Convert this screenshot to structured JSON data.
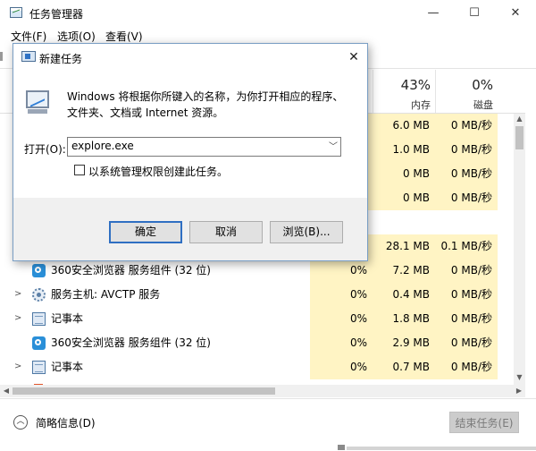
{
  "task_manager": {
    "title": "任务管理器",
    "window_buttons": {
      "minimize": "—",
      "maximize": "☐",
      "close": "✕"
    },
    "menu": [
      "文件(F)",
      "选项(O)",
      "查看(V)"
    ],
    "columns": {
      "memory": {
        "pct": "43%",
        "label": "内存"
      },
      "disk": {
        "pct": "0%",
        "label": "磁盘"
      }
    },
    "rows": [
      {
        "name": "",
        "cpu": "",
        "mem": "6.0 MB",
        "disk": "0 MB/秒"
      },
      {
        "name": "",
        "cpu": "",
        "mem": "1.0 MB",
        "disk": "0 MB/秒"
      },
      {
        "name": "",
        "cpu": "",
        "mem": "0 MB",
        "disk": "0 MB/秒"
      },
      {
        "name": "",
        "cpu": "",
        "mem": "0 MB",
        "disk": "0 MB/秒"
      },
      {
        "name": "",
        "cpu": "",
        "mem": "28.1 MB",
        "disk": "0.1 MB/秒"
      },
      {
        "name": "360安全浏览器 服务组件 (32 位)",
        "icon": "360-browser-icon",
        "expand": false,
        "cpu": "0%",
        "mem": "7.2 MB",
        "disk": "0 MB/秒"
      },
      {
        "name": "服务主机: AVCTP 服务",
        "icon": "service-host-icon",
        "expand": true,
        "cpu": "0%",
        "mem": "0.4 MB",
        "disk": "0 MB/秒"
      },
      {
        "name": "记事本",
        "icon": "notepad-icon",
        "expand": true,
        "cpu": "0%",
        "mem": "1.8 MB",
        "disk": "0 MB/秒"
      },
      {
        "name": "360安全浏览器 服务组件 (32 位)",
        "icon": "360-browser-icon",
        "expand": false,
        "cpu": "0%",
        "mem": "2.9 MB",
        "disk": "0 MB/秒"
      },
      {
        "name": "记事本",
        "icon": "notepad-icon",
        "expand": true,
        "cpu": "0%",
        "mem": "0.7 MB",
        "disk": "0 MB/秒"
      }
    ],
    "footer": {
      "fewer_details": "简略信息(D)",
      "end_task": "结束任务(E)"
    }
  },
  "run_dialog": {
    "title": "新建任务",
    "close": "✕",
    "description": "Windows 将根据你所键入的名称，为你打开相应的程序、文件夹、文档或 Internet 资源。",
    "open_label": "打开(O):",
    "open_value": "explore.exe",
    "admin_checkbox": {
      "label": "以系统管理权限创建此任务。",
      "checked": false
    },
    "buttons": {
      "ok": "确定",
      "cancel": "取消",
      "browse": "浏览(B)..."
    }
  },
  "colors": {
    "highlight_cells": "#fff4c4",
    "dialog_border": "#7a9ec4",
    "default_button_border": "#2f6fc2"
  }
}
